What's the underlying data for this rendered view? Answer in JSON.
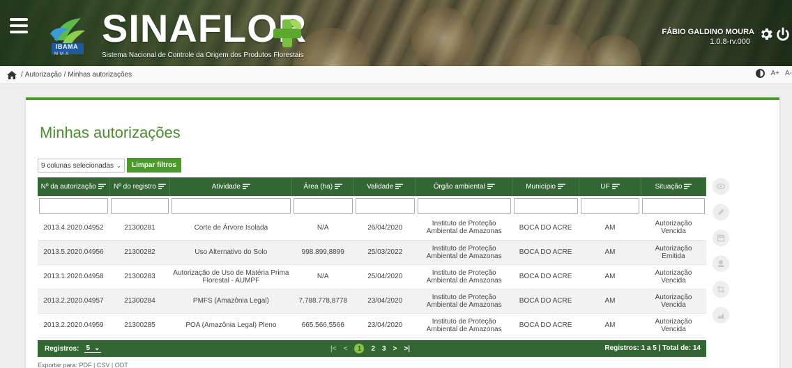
{
  "header": {
    "brand": "SINAFLOR",
    "subtitle": "Sistema Nacional de Controle da Origem dos Produtos Florestais",
    "logo_text": "IBAMA",
    "logo_sub": "MMA",
    "user_name": "FÁBIO GALDINO MOURA",
    "version": "1.0.8-rv.000"
  },
  "breadcrumb": {
    "items": [
      "Autorização",
      "Minhas autorizações"
    ],
    "separator": "/"
  },
  "accessibility": {
    "font_increase": "A+",
    "font_decrease": "A-"
  },
  "page": {
    "title": "Minhas autorizações",
    "column_selector": "9 colunas selecionadas",
    "clear_filters": "Limpar filtros"
  },
  "table": {
    "columns": [
      "Nº da autorização",
      "Nº do registro",
      "Atividade",
      "Área (ha)",
      "Validade",
      "Órgão ambiental",
      "Município",
      "UF",
      "Situação"
    ],
    "rows": [
      [
        "2013.4.2020.04952",
        "21300281",
        "Corte de Árvore Isolada",
        "N/A",
        "26/04/2020",
        "Instituto de Proteção Ambiental de Amazonas",
        "BOCA DO ACRE",
        "AM",
        "Autorização Vencida"
      ],
      [
        "2013.5.2020.04956",
        "21300282",
        "Uso Alternativo do Solo",
        "998.899,8899",
        "25/03/2022",
        "Instituto de Proteção Ambiental de Amazonas",
        "BOCA DO ACRE",
        "AM",
        "Autorização Emitida"
      ],
      [
        "2013.1.2020.04958",
        "21300283",
        "Autorização de Uso de Matéria Prima Florestal - AUMPF",
        "N/A",
        "25/04/2020",
        "Instituto de Proteção Ambiental de Amazonas",
        "BOCA DO ACRE",
        "AM",
        "Autorização Vencida"
      ],
      [
        "2013.2.2020.04957",
        "21300284",
        "PMFS (Amazônia Legal)",
        "7.788.778,8778",
        "23/04/2020",
        "Instituto de Proteção Ambiental de Amazonas",
        "BOCA DO ACRE",
        "AM",
        "Autorização Vencida"
      ],
      [
        "2013.2.2020.04959",
        "21300285",
        "POA (Amazônia Legal) Pleno",
        "665.566,5566",
        "23/04/2020",
        "Instituto de Proteção Ambiental de Amazonas",
        "BOCA DO ACRE",
        "AM",
        "Autorização Vencida"
      ]
    ]
  },
  "footer": {
    "records_label": "Registros:",
    "records_per_page": "5",
    "pages": [
      "1",
      "2",
      "3"
    ],
    "current_page": "1",
    "pager_first": "|<",
    "pager_prev": "<",
    "pager_next": ">",
    "pager_last": ">|",
    "total_text": "Registros: 1 a 5 | Total de: 14"
  },
  "export": {
    "label": "Exportar para:",
    "formats": [
      "PDF",
      "CSV",
      "ODT"
    ]
  },
  "actions": [
    "eye-icon",
    "pencil-icon",
    "calendar-icon",
    "stamp-icon",
    "crop-icon",
    "chart-icon"
  ],
  "colors": {
    "accent_green": "#4c9a2a",
    "table_header": "#336633",
    "title_green": "#4c8c2c"
  }
}
